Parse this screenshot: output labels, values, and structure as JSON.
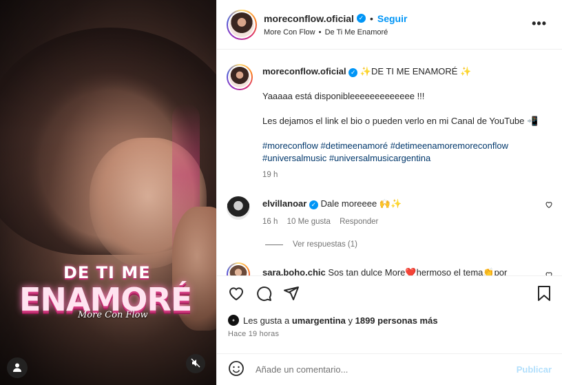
{
  "post": {
    "username": "moreconflow.oficial",
    "follow_label": "Seguir",
    "dot": "•",
    "audio_artist": "More Con Flow",
    "audio_track": "De Ti Me Enamoré",
    "more_label": "•••"
  },
  "media": {
    "title_small": "DE TI ME",
    "title_big": "ENAMORÉ",
    "title_sub": "More Con Flow"
  },
  "caption": {
    "username": "moreconflow.oficial",
    "headline": "✨DE TI ME ENAMORÉ ✨",
    "line1": "Yaaaaa está disponibleeeeeeeeeeeee !!!",
    "line2": "Les dejamos el link el bio o pueden verlo en mi Canal de YouTube 📲",
    "hashtags1": "#moreconflow #detimeenamoré #detimeenamoremoreconflow",
    "hashtags2": "#universalmusic #universalmusicargentina",
    "time": "19 h"
  },
  "comments": [
    {
      "username": "elvillanoar",
      "text": "Dale moreeee 🙌✨",
      "time": "16 h",
      "likes": "10 Me gusta",
      "reply": "Responder",
      "view_replies": "Ver respuestas (1)"
    },
    {
      "username": "sara.boho.chic",
      "text": "Sos tan dulce More❤️hermoso el tema👏por"
    }
  ],
  "likes": {
    "prefix": "Les gusta a",
    "user": "umargentina",
    "conj": "y",
    "others": "1899 personas más",
    "time_ago": "Hace 19 horas"
  },
  "comment_box": {
    "placeholder": "Añade un comentario...",
    "publish": "Publicar"
  },
  "colors": {
    "accent": "#0095f6",
    "hashtag": "#00376b",
    "muted": "#737373"
  }
}
